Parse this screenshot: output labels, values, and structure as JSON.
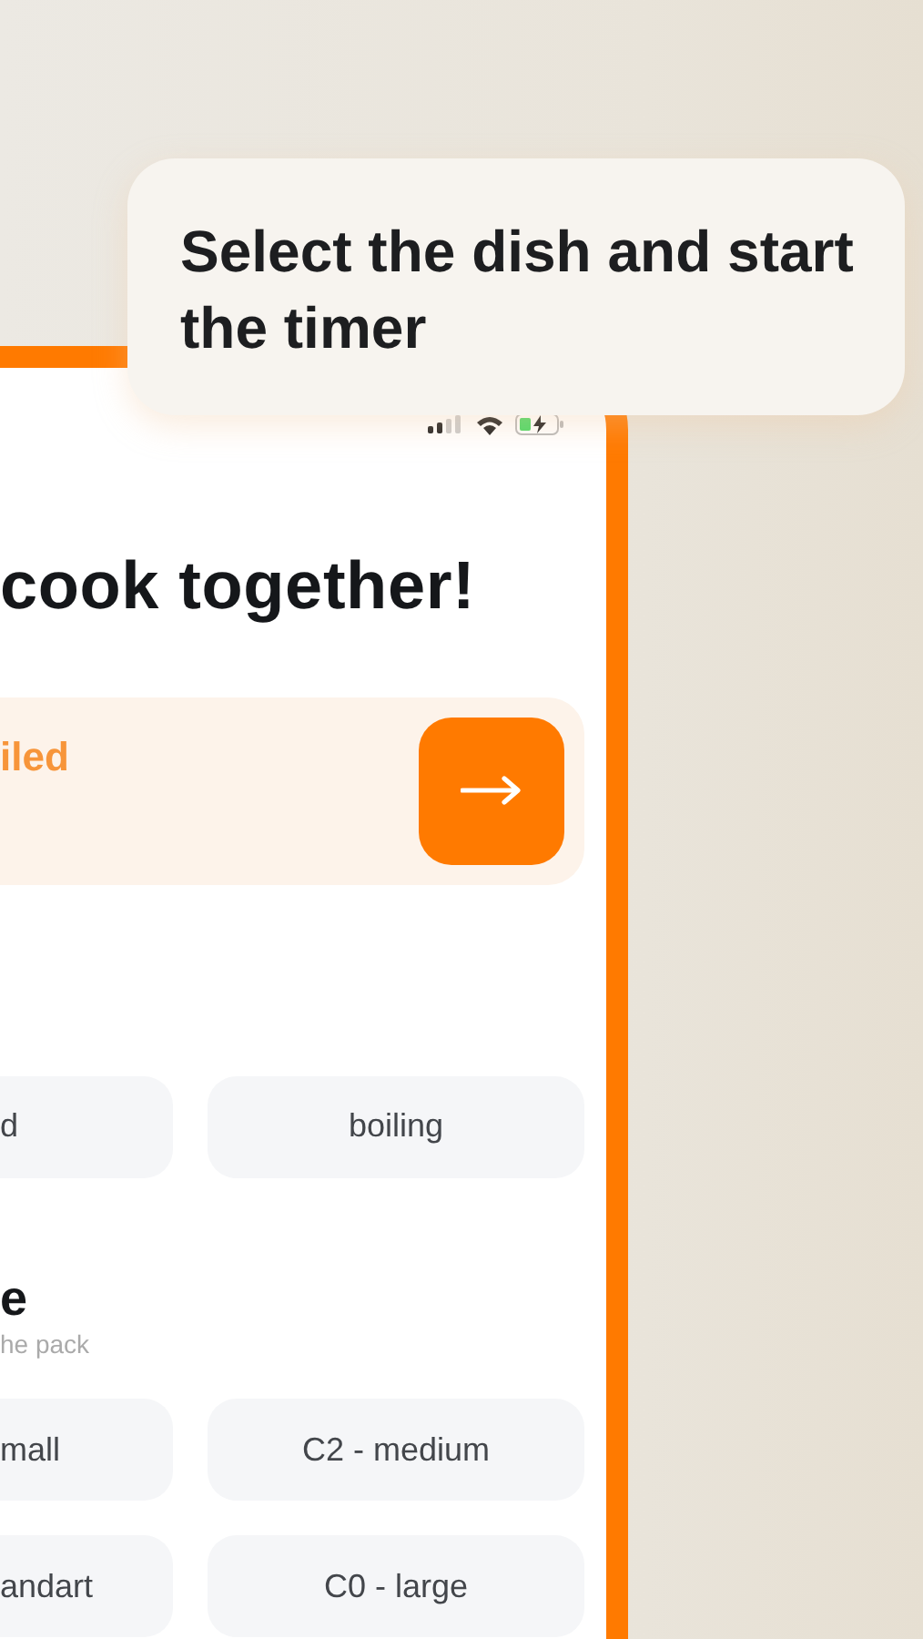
{
  "caption": "Select the dish and start the timer",
  "title": "cook together!",
  "banner": {
    "text": "iled"
  },
  "dish_types": [
    {
      "label": "d"
    },
    {
      "label": "boiling"
    }
  ],
  "size_section": {
    "title": "e",
    "subtitle": "he pack"
  },
  "sizes": [
    {
      "label": "mall"
    },
    {
      "label": "C2 - medium"
    },
    {
      "label": "andart"
    },
    {
      "label": "C0 - large"
    }
  ]
}
